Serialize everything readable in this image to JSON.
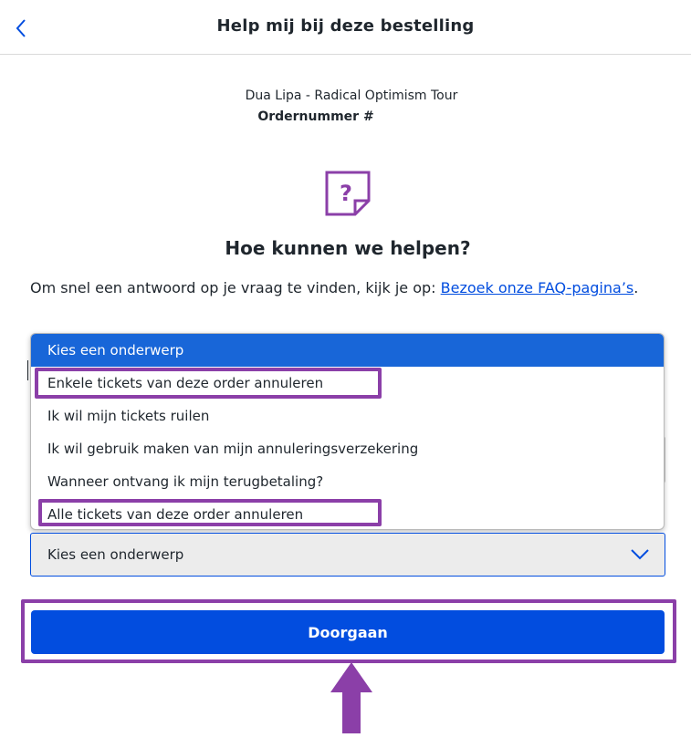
{
  "header": {
    "title": "Help mij bij deze bestelling"
  },
  "event": {
    "name": "Dua Lipa - Radical Optimism Tour",
    "order_label": "Ordernummer #"
  },
  "help": {
    "icon_glyph": "?",
    "heading": "Hoe kunnen we helpen?",
    "text_before_link": "Om snel een antwoord op je vraag te vinden, kijk je op: ",
    "link_text": "Bezoek onze FAQ-pagina’s",
    "text_after_link": "."
  },
  "dropdown": {
    "options": [
      "Kies een onderwerp",
      "Enkele tickets van deze order annuleren",
      "Ik wil mijn tickets ruilen",
      "Ik wil gebruik maken van mijn annuleringsverzekering",
      "Wanneer ontvang ik mijn terugbetaling?",
      "Alle tickets van deze order annuleren"
    ],
    "selected_index": 0
  },
  "select": {
    "value": "Kies een onderwerp"
  },
  "continue_button": {
    "label": "Doorgaan"
  },
  "colors": {
    "primary_blue": "#024ddf",
    "selected_option_blue": "#1866d8",
    "highlight_purple": "#8b3fa8",
    "text": "#1f262d"
  },
  "icons": {
    "back": "chevron-left-icon",
    "help": "question-mark-icon",
    "select": "chevron-down-icon",
    "annotation": "up-arrow-icon"
  }
}
